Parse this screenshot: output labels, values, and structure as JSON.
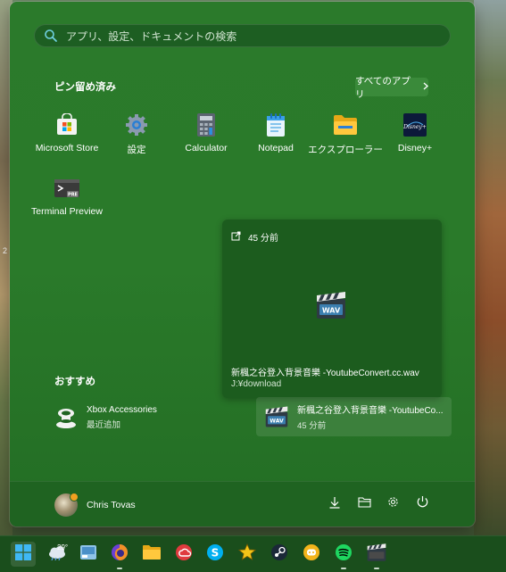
{
  "desktop": {
    "edge_label": "2"
  },
  "search": {
    "placeholder": "アプリ、設定、ドキュメントの検索"
  },
  "pinned": {
    "title": "ピン留め済み",
    "all_apps_label": "すべてのアプリ",
    "apps": [
      {
        "label": "Microsoft Store",
        "icon": "microsoft-store-icon"
      },
      {
        "label": "設定",
        "icon": "settings-gear-icon"
      },
      {
        "label": "Calculator",
        "icon": "calculator-icon"
      },
      {
        "label": "Notepad",
        "icon": "notepad-icon"
      },
      {
        "label": "エクスプローラー",
        "icon": "file-explorer-icon"
      },
      {
        "label": "Disney+",
        "icon": "disney-plus-icon"
      },
      {
        "label": "Terminal Preview",
        "icon": "terminal-preview-icon"
      }
    ]
  },
  "recent_card": {
    "time": "45 分前",
    "file_name": "新楓之谷登入背景音樂 -YoutubeConvert.cc.wav",
    "path": "J:¥download"
  },
  "recommended": {
    "title": "おすすめ",
    "items": [
      {
        "title": "Xbox Accessories",
        "subtitle": "最近追加",
        "icon": "xbox-accessories-icon"
      },
      {
        "title": "新楓之谷登入背景音樂 -YoutubeCo...",
        "subtitle": "45 分前",
        "icon": "wav-file-icon"
      }
    ]
  },
  "user": {
    "name": "Chris Tovas"
  },
  "taskbar": {
    "weather_temp": "29°"
  },
  "colors": {
    "menu_bg": "#2a7a2a",
    "footer_bg": "#1f6321",
    "taskbar_bg": "#1a4e1c"
  }
}
